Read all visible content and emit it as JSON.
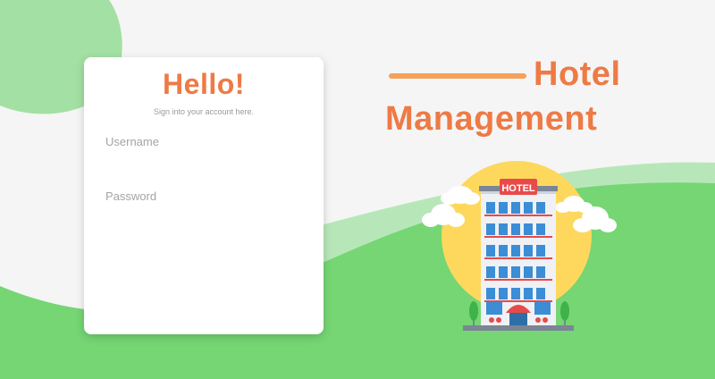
{
  "login": {
    "heading": "Hello!",
    "subtitle": "Sign into your account here.",
    "username_placeholder": "Username",
    "password_placeholder": "Password"
  },
  "hero": {
    "title_line1": "Hotel",
    "title_line2": "Management",
    "sign_text": "HOTEL"
  },
  "colors": {
    "accent": "#ee7a45",
    "green": "#75d673",
    "light_green": "#a3e0a3",
    "background": "#f5f5f5"
  },
  "icons": [
    "cloud-icon",
    "tree-icon",
    "hotel-building-icon"
  ]
}
